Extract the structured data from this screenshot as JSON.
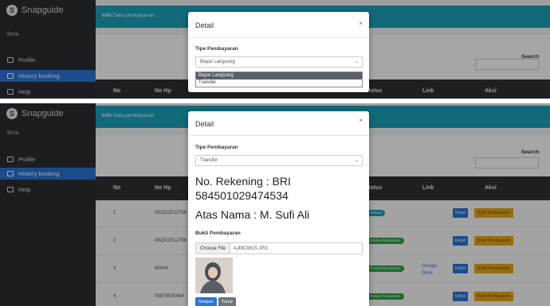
{
  "app": {
    "brand": "Snapguide",
    "role": "Beta"
  },
  "colors": {
    "sidebar": "#2b2d33",
    "accent": "#2b74d8",
    "topbar": "#1aa4bb",
    "success": "#28a745",
    "warning": "#e7a817",
    "info": "#17a2b8"
  },
  "sidebar": {
    "items": [
      {
        "label": "Profile",
        "icon": "profile-icon"
      },
      {
        "label": "History booking",
        "icon": "history-icon"
      },
      {
        "label": "Help",
        "icon": "help-icon"
      }
    ]
  },
  "top_screen": {
    "breadcrumb_bold": "Info",
    "breadcrumb_text": "Data pembayaran",
    "search_label": "Search:",
    "table_headers": [
      "No",
      "No Hp",
      "Status",
      "Link",
      "Aksi"
    ],
    "modal": {
      "title": "Detail",
      "close": "×",
      "field_label": "Tipe Pembayaran",
      "select_value": "Bayar Langsung",
      "options": [
        "Bayar Langsung",
        "Transfer"
      ]
    }
  },
  "bottom_screen": {
    "breadcrumb_bold": "Info",
    "breadcrumb_text": "Data pembayaran",
    "search_label": "Search:",
    "table_headers": [
      "No",
      "No Hp",
      "Status",
      "Link",
      "Aksi"
    ],
    "rows": [
      {
        "no": "1",
        "hp": "082322512766",
        "status": "Selesai",
        "status_color": "#17a2b8",
        "link": ""
      },
      {
        "no": "2",
        "hp": "082322512766",
        "status": "Proses Pemotretan",
        "status_color": "#28a745",
        "link": ""
      },
      {
        "no": "3",
        "hp": "65544",
        "status": "Proses Pemotretan",
        "status_color": "#28a745",
        "link": "Google Drive"
      },
      {
        "no": "4",
        "hp": "08879635454",
        "status": "Proses Pemotretan",
        "status_color": "#28a745",
        "link": ""
      }
    ],
    "row_buttons": {
      "detail": "Detail",
      "bukti": "Bukti Pembayaran"
    },
    "modal": {
      "title": "Detail",
      "close": "×",
      "field_label": "Tipe Pembayaran",
      "select_value": "Transfer",
      "rekening_line1": "No. Rekening : BRI",
      "rekening_line2": "584501029474534",
      "atas_nama": "Atas Nama : M. Sufi Ali",
      "bukti_label": "Bukti Pembayaran",
      "choose_file": "Choose File",
      "file_name": "AJMC9815.JPG",
      "save_button": "Simpan",
      "close_button": "Tutup"
    }
  }
}
